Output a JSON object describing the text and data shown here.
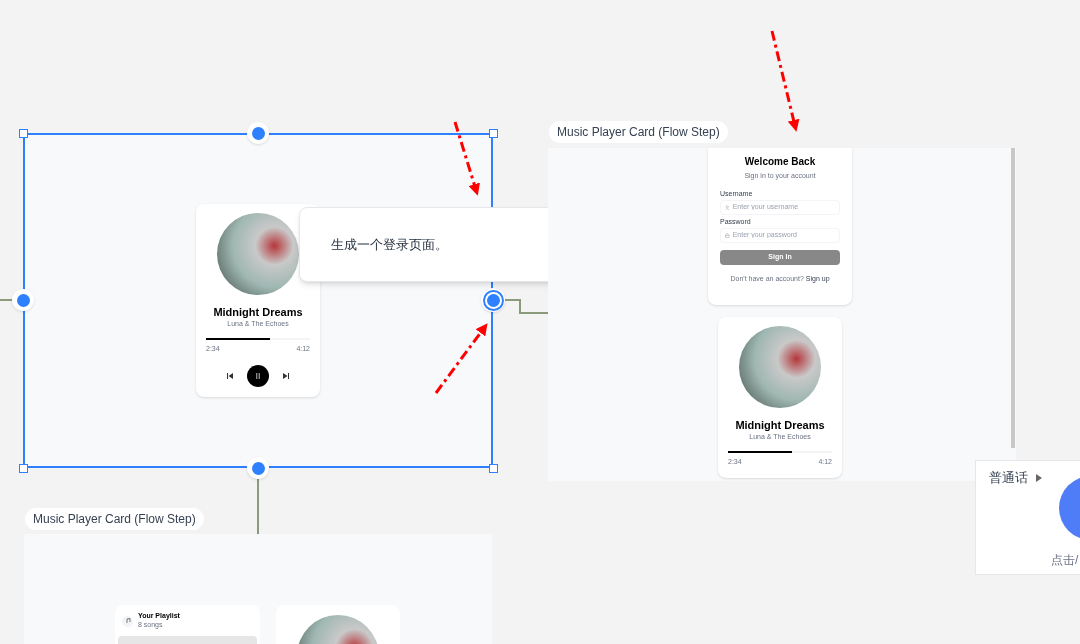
{
  "selected_frame": {
    "player": {
      "title": "Midnight Dreams",
      "artist": "Luna & The Echoes",
      "level": 0.62,
      "elapsed": "2:34",
      "total": "4:12",
      "playing": true
    }
  },
  "prompt_popup": {
    "text": "生成一个登录页面。"
  },
  "flow_step_frame": {
    "label": "Music Player Card (Flow Step)",
    "login": {
      "title": "Welcome Back",
      "subtitle": "Sign in to your account",
      "fields": [
        {
          "kind": "user",
          "label": "Username",
          "placeholder": "Enter your username"
        },
        {
          "kind": "lock",
          "label": "Password",
          "placeholder": "Enter your password"
        }
      ],
      "button": "Sign In",
      "footer": "Don't have an account?",
      "link": "Sign up"
    },
    "player": {
      "title": "Midnight Dreams",
      "artist": "Luna & The Echoes",
      "level": 0.62,
      "elapsed": "2:34",
      "total": "4:12"
    }
  },
  "second_flow_step_frame": {
    "label": "Music Player Card (Flow Step)",
    "playlist": {
      "title": "Your Playlist",
      "count": "8 songs"
    }
  },
  "voice_panel": {
    "language": "普通话",
    "hint": "点击/"
  }
}
